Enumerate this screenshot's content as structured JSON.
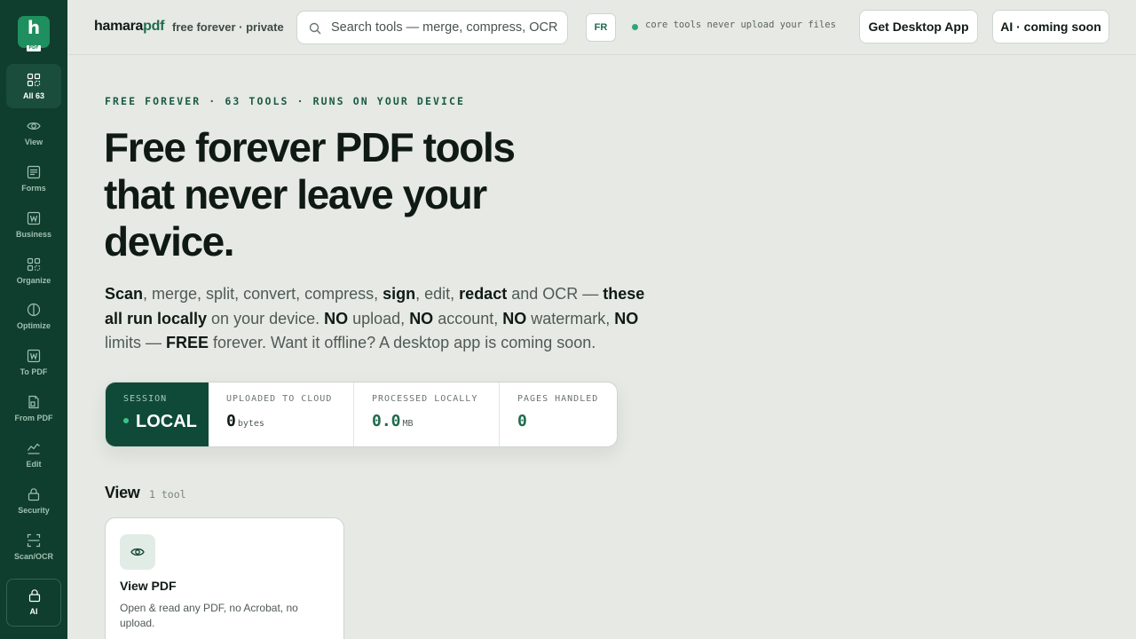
{
  "brand": {
    "logo_letter": "h",
    "logo_sub": "PDF",
    "name_a": "hamara",
    "name_b": "pdf",
    "tagline": "free forever · private"
  },
  "search": {
    "placeholder": "Search tools — merge, compress, OCR..."
  },
  "header": {
    "lang": "FR",
    "status": "core tools never upload your files",
    "desktop_button": "Get Desktop App",
    "ai_button": "AI · coming soon"
  },
  "sidebar": {
    "items": [
      {
        "label": "All 63",
        "icon": "grid-icon",
        "active": true
      },
      {
        "label": "View",
        "icon": "eye-icon"
      },
      {
        "label": "Forms",
        "icon": "form-icon"
      },
      {
        "label": "Business",
        "icon": "word-doc-icon"
      },
      {
        "label": "Organize",
        "icon": "grid-icon"
      },
      {
        "label": "Optimize",
        "icon": "half-circle-icon"
      },
      {
        "label": "To PDF",
        "icon": "word-doc-icon"
      },
      {
        "label": "From PDF",
        "icon": "file-export-icon"
      },
      {
        "label": "Edit",
        "icon": "edit-chart-icon"
      },
      {
        "label": "Security",
        "icon": "lock-icon"
      },
      {
        "label": "Scan/OCR",
        "icon": "scan-icon"
      },
      {
        "label": "AI",
        "icon": "lock-icon"
      }
    ]
  },
  "hero": {
    "kicker": "FREE FOREVER · 63 TOOLS · RUNS ON YOUR DEVICE",
    "title": "Free forever PDF tools that never leave your device.",
    "lead": [
      {
        "t": "Scan",
        "b": true
      },
      {
        "t": ", merge, split, convert, compress, "
      },
      {
        "t": "sign",
        "b": true
      },
      {
        "t": ", edit, "
      },
      {
        "t": "redact",
        "b": true
      },
      {
        "t": " and OCR — "
      },
      {
        "t": "these all run locally",
        "b": true
      },
      {
        "t": " on your device. "
      },
      {
        "t": "NO",
        "b": true
      },
      {
        "t": " upload, "
      },
      {
        "t": "NO",
        "b": true
      },
      {
        "t": " account, "
      },
      {
        "t": "NO",
        "b": true
      },
      {
        "t": " watermark, "
      },
      {
        "t": "NO",
        "b": true
      },
      {
        "t": " limits — "
      },
      {
        "t": "FREE",
        "b": true
      },
      {
        "t": " forever. Want it offline? A desktop app is coming soon."
      }
    ]
  },
  "stats": {
    "session_label": "SESSION",
    "session_value": "LOCAL",
    "uploaded_label": "UPLOADED TO CLOUD",
    "uploaded_value": "0",
    "uploaded_unit": "bytes",
    "processed_label": "PROCESSED LOCALLY",
    "processed_value": "0.0",
    "processed_unit": "MB",
    "pages_label": "PAGES HANDLED",
    "pages_value": "0"
  },
  "section": {
    "title": "View",
    "count": "1 tool"
  },
  "cards": [
    {
      "title": "View PDF",
      "desc": "Open & read any PDF, no Acrobat, no upload.",
      "icon": "eye-icon"
    }
  ],
  "colors": {
    "sidebar": "#0f3d2e",
    "accent": "#1f6b4d",
    "logo": "#1f8f5f",
    "background": "#e6e9e4"
  }
}
